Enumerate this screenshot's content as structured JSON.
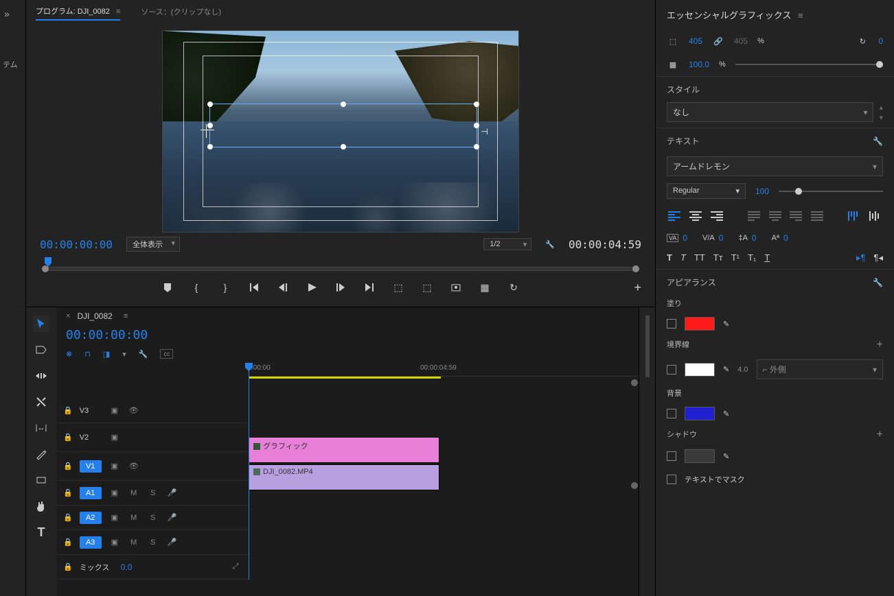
{
  "leftStrip": {
    "arrows": "»",
    "sideLabel": "テム"
  },
  "tabs": {
    "program": "プログラム: DJI_0082",
    "source": "ソース：(クリップなし)"
  },
  "program": {
    "timecodeLeft": "00:00:00:00",
    "zoom": "全体表示",
    "ratio": "1/2",
    "timecodeRight": "00:00:04:59"
  },
  "timeline": {
    "name": "DJI_0082",
    "timecode": "00:00:00:00",
    "ruler": {
      "t0": ":00:00",
      "t1": "00:00:04:59"
    },
    "tracks": {
      "v3": "V3",
      "v2": "V2",
      "v1": "V1",
      "a1": "A1",
      "a2": "A2",
      "a3": "A3",
      "mix": "ミックス",
      "mixVal": "0.0",
      "m": "M",
      "s": "S"
    },
    "clips": {
      "gfx": "グラフィック",
      "vid": "DJI_0082.MP4"
    }
  },
  "egp": {
    "title": "エッセンシャルグラフィックス",
    "w": "405",
    "h": "405",
    "pct": "%",
    "rot": "0",
    "opacity": "100.0",
    "opacityUnit": "%",
    "style": {
      "head": "スタイル",
      "none": "なし"
    },
    "text": {
      "head": "テキスト",
      "font": "アームドレモン",
      "weight": "Regular",
      "size": "100",
      "va": "0",
      "va2": "0",
      "tsume": "0",
      "baseline": "0"
    },
    "t": "T",
    "tItalic": "T",
    "tt": "TT",
    "tSmall": "Tᴛ",
    "tSup": "T¹",
    "tSub": "T₁",
    "tUnder": "T",
    "appearance": {
      "head": "アピアランス",
      "fill": "塗り",
      "stroke": "境界線",
      "strokeW": "4.0",
      "strokePos": "外側",
      "bg": "背景",
      "shadow": "シャドウ",
      "mask": "テキストでマスク"
    },
    "colors": {
      "fill": "#ff1a1a",
      "stroke": "#ffffff",
      "bg": "#2020d0",
      "shadow": "#3a3a3a"
    }
  }
}
